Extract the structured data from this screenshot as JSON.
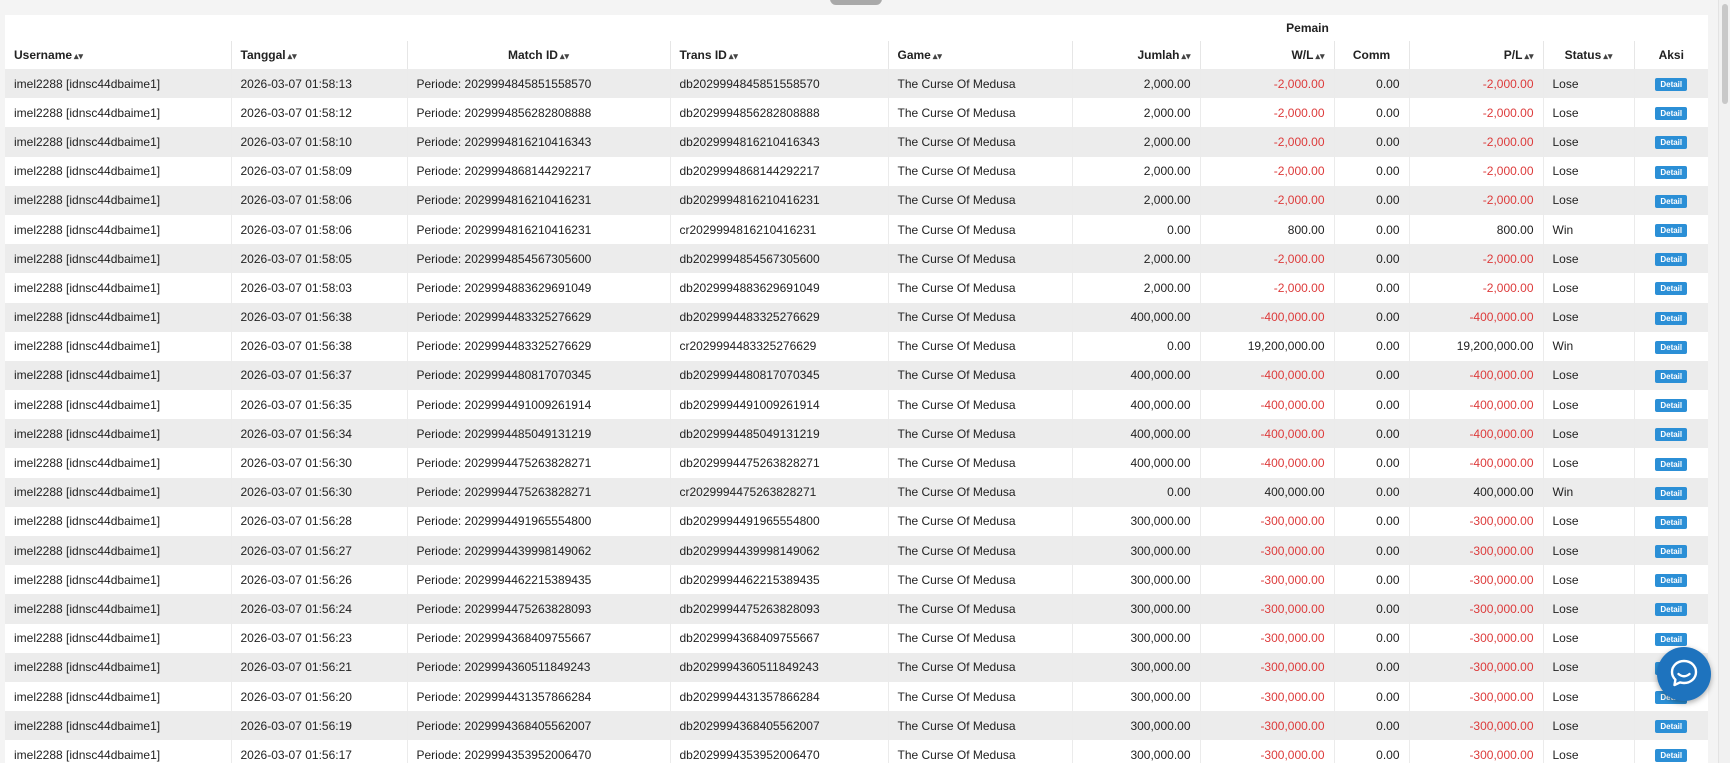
{
  "header": {
    "group_label": "Pemain",
    "columns": [
      "Username",
      "Tanggal",
      "Match ID",
      "Trans ID",
      "Game",
      "Jumlah",
      "W/L",
      "Comm",
      "P/L",
      "Status",
      "Aksi"
    ]
  },
  "icons": {
    "sort": "sort-icon",
    "chat": "chat-bubble-icon"
  },
  "colors": {
    "negative": "#dd3b3b",
    "button": "#2b8fd6",
    "chat": "#1e73be"
  },
  "rows": [
    {
      "username": "imel2288 [idnsc44dbaime1]",
      "tanggal": "2026-03-07 01:58:13",
      "match_id": "Periode: 2029994845851558570",
      "trans_id": "db2029994845851558570",
      "game": "The Curse Of Medusa",
      "jumlah": "2,000.00",
      "wl": "-2,000.00",
      "comm": "0.00",
      "pl": "-2,000.00",
      "status": "Lose",
      "aksi": "Detail"
    },
    {
      "username": "imel2288 [idnsc44dbaime1]",
      "tanggal": "2026-03-07 01:58:12",
      "match_id": "Periode: 2029994856282808888",
      "trans_id": "db2029994856282808888",
      "game": "The Curse Of Medusa",
      "jumlah": "2,000.00",
      "wl": "-2,000.00",
      "comm": "0.00",
      "pl": "-2,000.00",
      "status": "Lose",
      "aksi": "Detail"
    },
    {
      "username": "imel2288 [idnsc44dbaime1]",
      "tanggal": "2026-03-07 01:58:10",
      "match_id": "Periode: 2029994816210416343",
      "trans_id": "db2029994816210416343",
      "game": "The Curse Of Medusa",
      "jumlah": "2,000.00",
      "wl": "-2,000.00",
      "comm": "0.00",
      "pl": "-2,000.00",
      "status": "Lose",
      "aksi": "Detail"
    },
    {
      "username": "imel2288 [idnsc44dbaime1]",
      "tanggal": "2026-03-07 01:58:09",
      "match_id": "Periode: 2029994868144292217",
      "trans_id": "db2029994868144292217",
      "game": "The Curse Of Medusa",
      "jumlah": "2,000.00",
      "wl": "-2,000.00",
      "comm": "0.00",
      "pl": "-2,000.00",
      "status": "Lose",
      "aksi": "Detail"
    },
    {
      "username": "imel2288 [idnsc44dbaime1]",
      "tanggal": "2026-03-07 01:58:06",
      "match_id": "Periode: 2029994816210416231",
      "trans_id": "db2029994816210416231",
      "game": "The Curse Of Medusa",
      "jumlah": "2,000.00",
      "wl": "-2,000.00",
      "comm": "0.00",
      "pl": "-2,000.00",
      "status": "Lose",
      "aksi": "Detail"
    },
    {
      "username": "imel2288 [idnsc44dbaime1]",
      "tanggal": "2026-03-07 01:58:06",
      "match_id": "Periode: 2029994816210416231",
      "trans_id": "cr2029994816210416231",
      "game": "The Curse Of Medusa",
      "jumlah": "0.00",
      "wl": "800.00",
      "comm": "0.00",
      "pl": "800.00",
      "status": "Win",
      "aksi": "Detail"
    },
    {
      "username": "imel2288 [idnsc44dbaime1]",
      "tanggal": "2026-03-07 01:58:05",
      "match_id": "Periode: 2029994854567305600",
      "trans_id": "db2029994854567305600",
      "game": "The Curse Of Medusa",
      "jumlah": "2,000.00",
      "wl": "-2,000.00",
      "comm": "0.00",
      "pl": "-2,000.00",
      "status": "Lose",
      "aksi": "Detail"
    },
    {
      "username": "imel2288 [idnsc44dbaime1]",
      "tanggal": "2026-03-07 01:58:03",
      "match_id": "Periode: 2029994883629691049",
      "trans_id": "db2029994883629691049",
      "game": "The Curse Of Medusa",
      "jumlah": "2,000.00",
      "wl": "-2,000.00",
      "comm": "0.00",
      "pl": "-2,000.00",
      "status": "Lose",
      "aksi": "Detail"
    },
    {
      "username": "imel2288 [idnsc44dbaime1]",
      "tanggal": "2026-03-07 01:56:38",
      "match_id": "Periode: 2029994483325276629",
      "trans_id": "db2029994483325276629",
      "game": "The Curse Of Medusa",
      "jumlah": "400,000.00",
      "wl": "-400,000.00",
      "comm": "0.00",
      "pl": "-400,000.00",
      "status": "Lose",
      "aksi": "Detail"
    },
    {
      "username": "imel2288 [idnsc44dbaime1]",
      "tanggal": "2026-03-07 01:56:38",
      "match_id": "Periode: 2029994483325276629",
      "trans_id": "cr2029994483325276629",
      "game": "The Curse Of Medusa",
      "jumlah": "0.00",
      "wl": "19,200,000.00",
      "comm": "0.00",
      "pl": "19,200,000.00",
      "status": "Win",
      "aksi": "Detail"
    },
    {
      "username": "imel2288 [idnsc44dbaime1]",
      "tanggal": "2026-03-07 01:56:37",
      "match_id": "Periode: 2029994480817070345",
      "trans_id": "db2029994480817070345",
      "game": "The Curse Of Medusa",
      "jumlah": "400,000.00",
      "wl": "-400,000.00",
      "comm": "0.00",
      "pl": "-400,000.00",
      "status": "Lose",
      "aksi": "Detail"
    },
    {
      "username": "imel2288 [idnsc44dbaime1]",
      "tanggal": "2026-03-07 01:56:35",
      "match_id": "Periode: 2029994491009261914",
      "trans_id": "db2029994491009261914",
      "game": "The Curse Of Medusa",
      "jumlah": "400,000.00",
      "wl": "-400,000.00",
      "comm": "0.00",
      "pl": "-400,000.00",
      "status": "Lose",
      "aksi": "Detail"
    },
    {
      "username": "imel2288 [idnsc44dbaime1]",
      "tanggal": "2026-03-07 01:56:34",
      "match_id": "Periode: 2029994485049131219",
      "trans_id": "db2029994485049131219",
      "game": "The Curse Of Medusa",
      "jumlah": "400,000.00",
      "wl": "-400,000.00",
      "comm": "0.00",
      "pl": "-400,000.00",
      "status": "Lose",
      "aksi": "Detail"
    },
    {
      "username": "imel2288 [idnsc44dbaime1]",
      "tanggal": "2026-03-07 01:56:30",
      "match_id": "Periode: 2029994475263828271",
      "trans_id": "db2029994475263828271",
      "game": "The Curse Of Medusa",
      "jumlah": "400,000.00",
      "wl": "-400,000.00",
      "comm": "0.00",
      "pl": "-400,000.00",
      "status": "Lose",
      "aksi": "Detail"
    },
    {
      "username": "imel2288 [idnsc44dbaime1]",
      "tanggal": "2026-03-07 01:56:30",
      "match_id": "Periode: 2029994475263828271",
      "trans_id": "cr2029994475263828271",
      "game": "The Curse Of Medusa",
      "jumlah": "0.00",
      "wl": "400,000.00",
      "comm": "0.00",
      "pl": "400,000.00",
      "status": "Win",
      "aksi": "Detail"
    },
    {
      "username": "imel2288 [idnsc44dbaime1]",
      "tanggal": "2026-03-07 01:56:28",
      "match_id": "Periode: 2029994491965554800",
      "trans_id": "db2029994491965554800",
      "game": "The Curse Of Medusa",
      "jumlah": "300,000.00",
      "wl": "-300,000.00",
      "comm": "0.00",
      "pl": "-300,000.00",
      "status": "Lose",
      "aksi": "Detail"
    },
    {
      "username": "imel2288 [idnsc44dbaime1]",
      "tanggal": "2026-03-07 01:56:27",
      "match_id": "Periode: 2029994439998149062",
      "trans_id": "db2029994439998149062",
      "game": "The Curse Of Medusa",
      "jumlah": "300,000.00",
      "wl": "-300,000.00",
      "comm": "0.00",
      "pl": "-300,000.00",
      "status": "Lose",
      "aksi": "Detail"
    },
    {
      "username": "imel2288 [idnsc44dbaime1]",
      "tanggal": "2026-03-07 01:56:26",
      "match_id": "Periode: 2029994462215389435",
      "trans_id": "db2029994462215389435",
      "game": "The Curse Of Medusa",
      "jumlah": "300,000.00",
      "wl": "-300,000.00",
      "comm": "0.00",
      "pl": "-300,000.00",
      "status": "Lose",
      "aksi": "Detail"
    },
    {
      "username": "imel2288 [idnsc44dbaime1]",
      "tanggal": "2026-03-07 01:56:24",
      "match_id": "Periode: 2029994475263828093",
      "trans_id": "db2029994475263828093",
      "game": "The Curse Of Medusa",
      "jumlah": "300,000.00",
      "wl": "-300,000.00",
      "comm": "0.00",
      "pl": "-300,000.00",
      "status": "Lose",
      "aksi": "Detail"
    },
    {
      "username": "imel2288 [idnsc44dbaime1]",
      "tanggal": "2026-03-07 01:56:23",
      "match_id": "Periode: 2029994368409755667",
      "trans_id": "db2029994368409755667",
      "game": "The Curse Of Medusa",
      "jumlah": "300,000.00",
      "wl": "-300,000.00",
      "comm": "0.00",
      "pl": "-300,000.00",
      "status": "Lose",
      "aksi": "Detail"
    },
    {
      "username": "imel2288 [idnsc44dbaime1]",
      "tanggal": "2026-03-07 01:56:21",
      "match_id": "Periode: 2029994360511849243",
      "trans_id": "db2029994360511849243",
      "game": "The Curse Of Medusa",
      "jumlah": "300,000.00",
      "wl": "-300,000.00",
      "comm": "0.00",
      "pl": "-300,000.00",
      "status": "Lose",
      "aksi": "Detail"
    },
    {
      "username": "imel2288 [idnsc44dbaime1]",
      "tanggal": "2026-03-07 01:56:20",
      "match_id": "Periode: 2029994431357866284",
      "trans_id": "db2029994431357866284",
      "game": "The Curse Of Medusa",
      "jumlah": "300,000.00",
      "wl": "-300,000.00",
      "comm": "0.00",
      "pl": "-300,000.00",
      "status": "Lose",
      "aksi": "Detail"
    },
    {
      "username": "imel2288 [idnsc44dbaime1]",
      "tanggal": "2026-03-07 01:56:19",
      "match_id": "Periode: 2029994368405562007",
      "trans_id": "db2029994368405562007",
      "game": "The Curse Of Medusa",
      "jumlah": "300,000.00",
      "wl": "-300,000.00",
      "comm": "0.00",
      "pl": "-300,000.00",
      "status": "Lose",
      "aksi": "Detail"
    },
    {
      "username": "imel2288 [idnsc44dbaime1]",
      "tanggal": "2026-03-07 01:56:17",
      "match_id": "Periode: 2029994353952006470",
      "trans_id": "db2029994353952006470",
      "game": "The Curse Of Medusa",
      "jumlah": "300,000.00",
      "wl": "-300,000.00",
      "comm": "0.00",
      "pl": "-300,000.00",
      "status": "Lose",
      "aksi": "Detail"
    }
  ]
}
